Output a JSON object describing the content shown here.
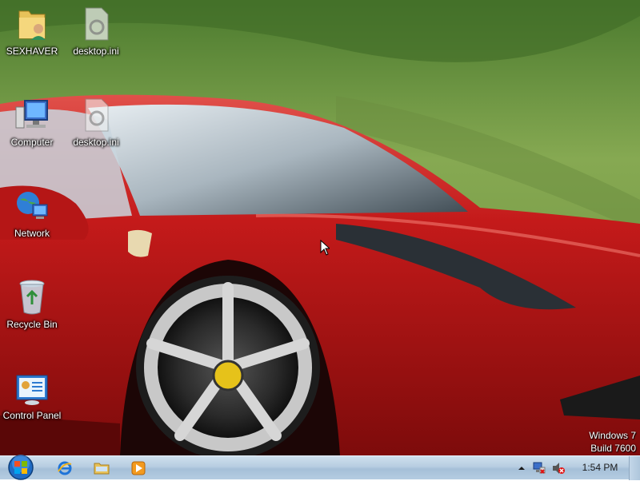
{
  "desktop_icons": [
    {
      "name": "SEXHAVER",
      "icon": "user-folder-icon"
    },
    {
      "name": "desktop.ini",
      "icon": "settings-file-icon"
    },
    {
      "name": "Computer",
      "icon": "computer-icon"
    },
    {
      "name": "desktop.ini",
      "icon": "settings-file-icon"
    },
    {
      "name": "Network",
      "icon": "network-icon"
    },
    {
      "name": "Recycle Bin",
      "icon": "recycle-bin-icon"
    },
    {
      "name": "Control Panel",
      "icon": "control-panel-icon"
    }
  ],
  "watermark": {
    "line1": "Windows 7",
    "line2": "Build 7600"
  },
  "taskbar": {
    "pinned": [
      {
        "name": "Internet Explorer",
        "icon": "internet-explorer-icon"
      },
      {
        "name": "Windows Explorer",
        "icon": "folder-icon"
      },
      {
        "name": "Windows Media Player",
        "icon": "media-player-icon"
      }
    ],
    "tray": {
      "icons": [
        "show-hidden-icons-arrow",
        "network-disconnected-icon",
        "volume-muted-icon"
      ],
      "time": "1:54 PM"
    }
  },
  "colors": {
    "car_red": "#c41a1a",
    "taskbar_blue": "#b7cde1",
    "start_orb_blue": "#1f6bc4"
  }
}
